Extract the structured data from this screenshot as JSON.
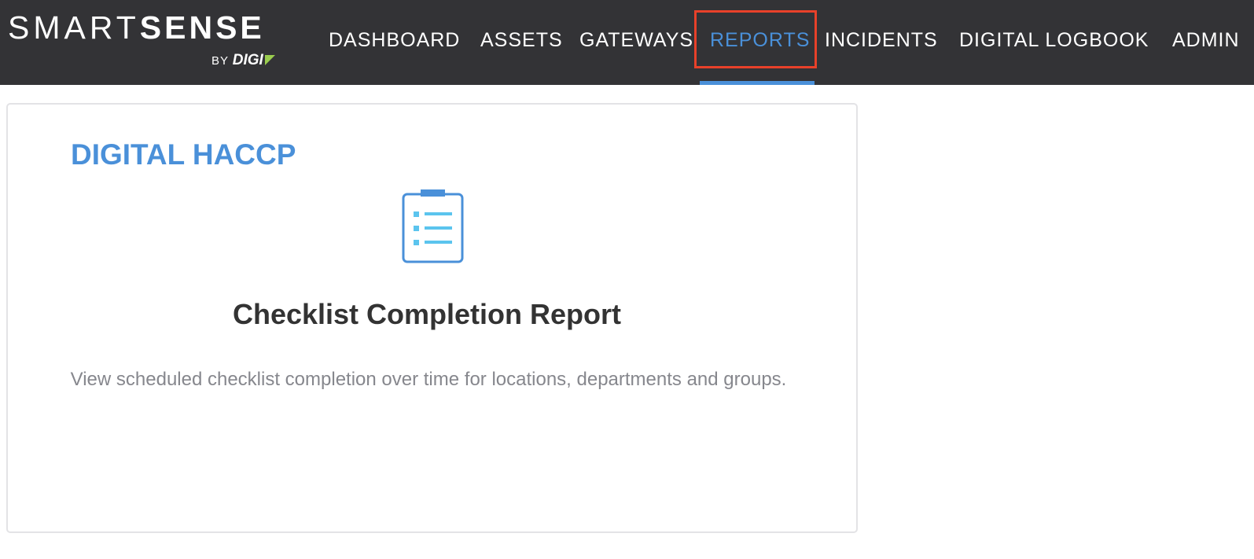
{
  "brand": {
    "smart": "SMART",
    "sense": "SENSE",
    "by": "BY",
    "digi": "DIGI",
    "accent_color": "#9acd4e"
  },
  "nav": {
    "items": [
      {
        "label": "DASHBOARD",
        "active": false
      },
      {
        "label": "ASSETS",
        "active": false
      },
      {
        "label": "GATEWAYS",
        "active": false
      },
      {
        "label": "REPORTS",
        "active": true
      },
      {
        "label": "INCIDENTS",
        "active": false
      },
      {
        "label": "DIGITAL LOGBOOK",
        "active": false
      },
      {
        "label": "ADMIN",
        "active": false
      }
    ],
    "active_color": "#4a90d9",
    "highlight_color": "#e8412a"
  },
  "section": {
    "title": "DIGITAL HACCP"
  },
  "report_card": {
    "icon": "clipboard-list-icon",
    "title": "Checklist Completion Report",
    "description": "View scheduled checklist completion over time for locations, departments and groups."
  }
}
